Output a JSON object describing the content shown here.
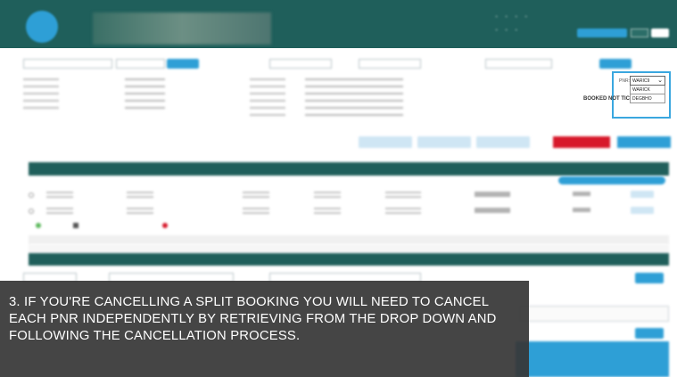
{
  "pnr_selector": {
    "label": "PNR:",
    "selected": "WARIC9",
    "options": [
      "WARICK",
      "DEGBHO"
    ]
  },
  "booked_status": "BOOKED NOT TIC",
  "caption": "3. IF YOU'RE CANCELLING A SPLIT BOOKING YOU WILL NEED TO CANCEL EACH PNR INDEPENDENTLY BY RETRIEVING FROM THE DROP DOWN AND FOLLOWING THE CANCELLATION PROCESS.",
  "colors": {
    "header_teal": "#1f5f5b",
    "accent_blue": "#2e9fd6",
    "cancel_red": "#d7182a",
    "callout_border": "#3aa7df",
    "caption_bg": "#373737"
  },
  "icons": [
    "chevron-down-icon",
    "pencil-icon",
    "radio-icon"
  ]
}
